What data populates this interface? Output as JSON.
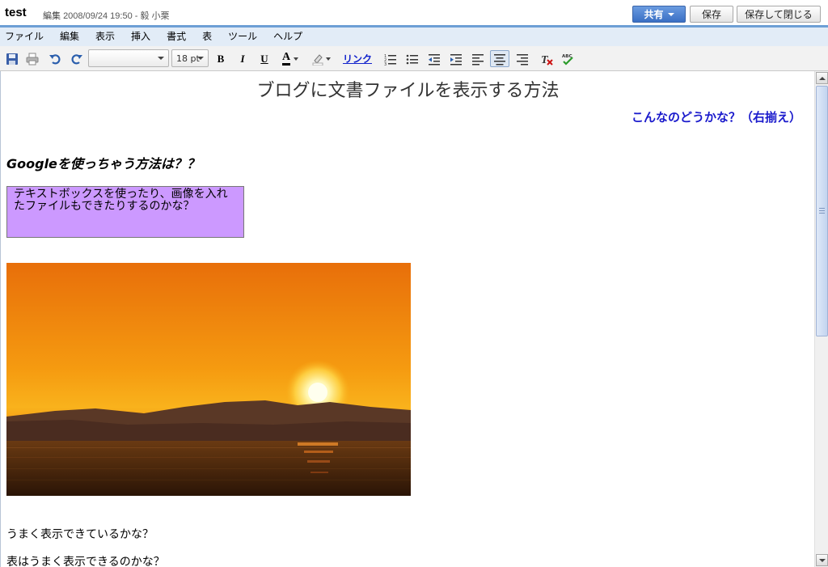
{
  "header": {
    "title": "test",
    "edit_label": "編集",
    "timestamp": "2008/09/24 19:50",
    "author": "- 毅 小栗",
    "share_label": "共有",
    "save_label": "保存",
    "save_close_label": "保存して閉じる"
  },
  "menu": {
    "items": [
      "ファイル",
      "編集",
      "表示",
      "挿入",
      "書式",
      "表",
      "ツール",
      "ヘルプ"
    ]
  },
  "toolbar": {
    "font_value": "",
    "size_value": "18 pt",
    "bold": "B",
    "italic": "I",
    "underline": "U",
    "text_color": "A",
    "link_label": "リンク",
    "spell": "ABC",
    "icons": [
      "save-icon",
      "print-icon",
      "undo-icon",
      "redo-icon",
      "numbered-list-icon",
      "bullet-list-icon",
      "outdent-icon",
      "indent-icon",
      "align-left-icon",
      "align-center-icon",
      "align-right-icon",
      "clear-format-icon",
      "spellcheck-icon"
    ],
    "accent_color": "#1a1acc"
  },
  "document": {
    "heading": "ブログに文書ファイルを表示する方法",
    "right_line": "こんなのどうかな？（右揃え）",
    "subheading": "Googleを使っちゃう方法は？？",
    "textbox": "テキストボックスを使ったり、画像を入れたファイルもできたりするのかな？",
    "textbox_color": "#cc99ff",
    "paragraph1": "うまく表示できているかな？",
    "paragraph2": "表はうまく表示できるのかな？"
  }
}
